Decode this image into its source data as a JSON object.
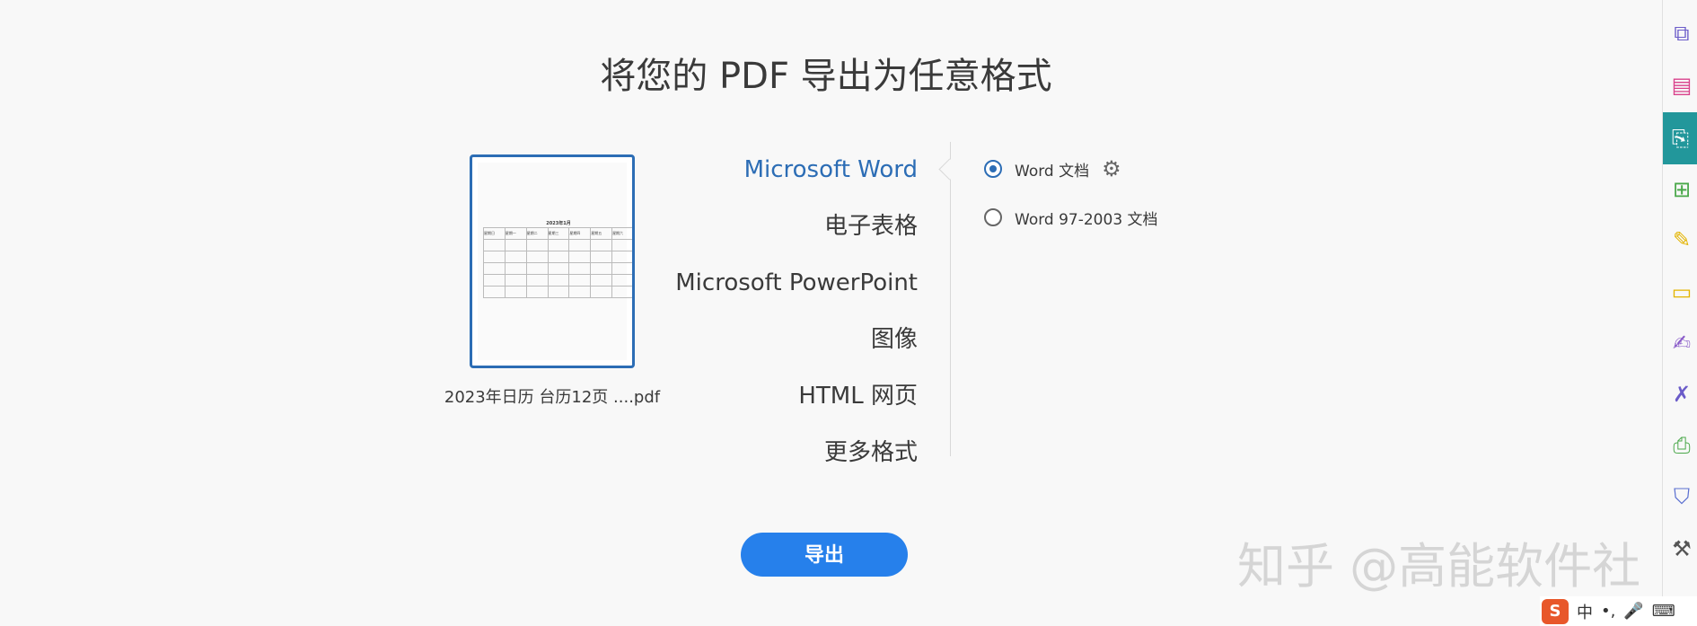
{
  "title": "将您的 PDF 导出为任意格式",
  "file": {
    "name": "2023年日历 台历12页 ....pdf",
    "preview_caption": "2023年1月",
    "weekdays": [
      "星期日",
      "星期一",
      "星期二",
      "星期三",
      "星期四",
      "星期五",
      "星期六"
    ]
  },
  "formats": [
    {
      "label": "Microsoft Word",
      "active": true
    },
    {
      "label": "电子表格"
    },
    {
      "label": "Microsoft PowerPoint"
    },
    {
      "label": "图像"
    },
    {
      "label": "HTML 网页"
    },
    {
      "label": "更多格式"
    }
  ],
  "options": [
    {
      "label": "Word 文档",
      "selected": true
    },
    {
      "label": "Word 97-2003 文档",
      "selected": false
    }
  ],
  "export_label": "导出",
  "watermark": "知乎 @高能软件社",
  "tools": [
    {
      "icon": "combine-files-icon",
      "color": "#6b5cc9"
    },
    {
      "icon": "organize-pages-icon",
      "color": "#d9428b"
    },
    {
      "icon": "export-pdf-icon",
      "color": "#ffffff"
    },
    {
      "icon": "create-pdf-icon",
      "color": "#4aa84a"
    },
    {
      "icon": "edit-pdf-icon",
      "color": "#e3b400"
    },
    {
      "icon": "comment-icon",
      "color": "#e3b400"
    },
    {
      "icon": "fill-sign-icon",
      "color": "#8a5cc9"
    },
    {
      "icon": "signature-icon",
      "color": "#6b5cc9"
    },
    {
      "icon": "print-production-icon",
      "color": "#4aa84a"
    },
    {
      "icon": "protect-icon",
      "color": "#5a6fd0"
    },
    {
      "icon": "more-tools-icon",
      "color": "#555555"
    }
  ],
  "ime": {
    "brand": "S",
    "mode": "中",
    "punct": "•,"
  },
  "colors": {
    "accent": "#2c6db5",
    "button": "#2680eb",
    "active_tool": "#22979b"
  }
}
